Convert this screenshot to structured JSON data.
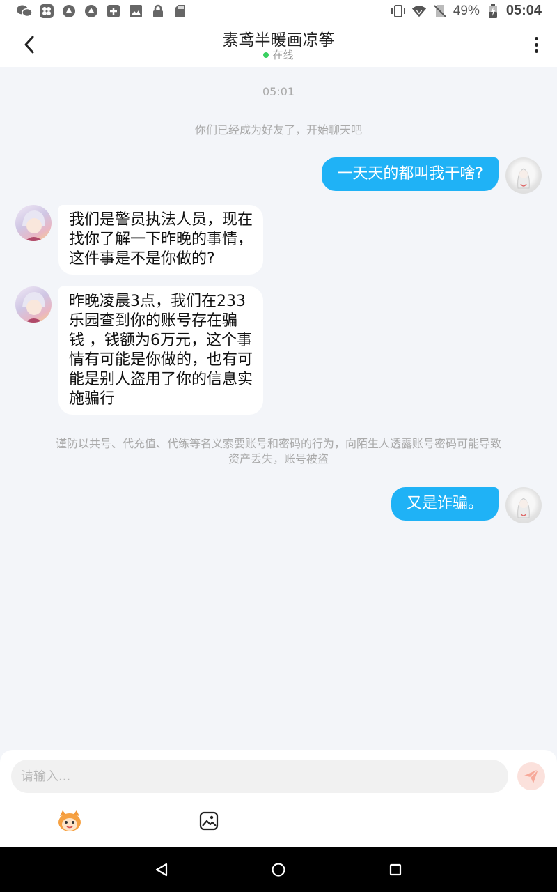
{
  "status_bar": {
    "battery": "49%",
    "time": "05:04"
  },
  "header": {
    "title": "素鸢半暖画凉筝",
    "status": "在线"
  },
  "chat": {
    "timestamp": "05:01",
    "friend_notice": "你们已经成为好友了，开始聊天吧",
    "msg1": "一天天的都叫我干啥?",
    "msg2_lines": [
      "我们是警员执法人员，现在",
      "找你了解一下昨晚的事情，",
      "这件事是不是你做的?"
    ],
    "msg3_lines": [
      "昨晚凌晨3点，我们在233",
      "乐园查到你的账号存在骗",
      "钱 ，钱额为6万元，这个事",
      "情有可能是你做的，也有可",
      "能是别人盗用了你的信息实",
      "施骗行"
    ],
    "warning_lines": [
      "谨防以共号、代充值、代练等名义索要账号和密码的行为，向陌生人透露账号密码可能导致",
      "资产丢失，账号被盗"
    ],
    "msg4": "又是诈骗。"
  },
  "input": {
    "placeholder": "请输入..."
  },
  "colors": {
    "accent": "#1fb2f6",
    "online": "#3ad061",
    "send_bg": "#fbe1dc",
    "send_icon": "#f7a99a"
  }
}
